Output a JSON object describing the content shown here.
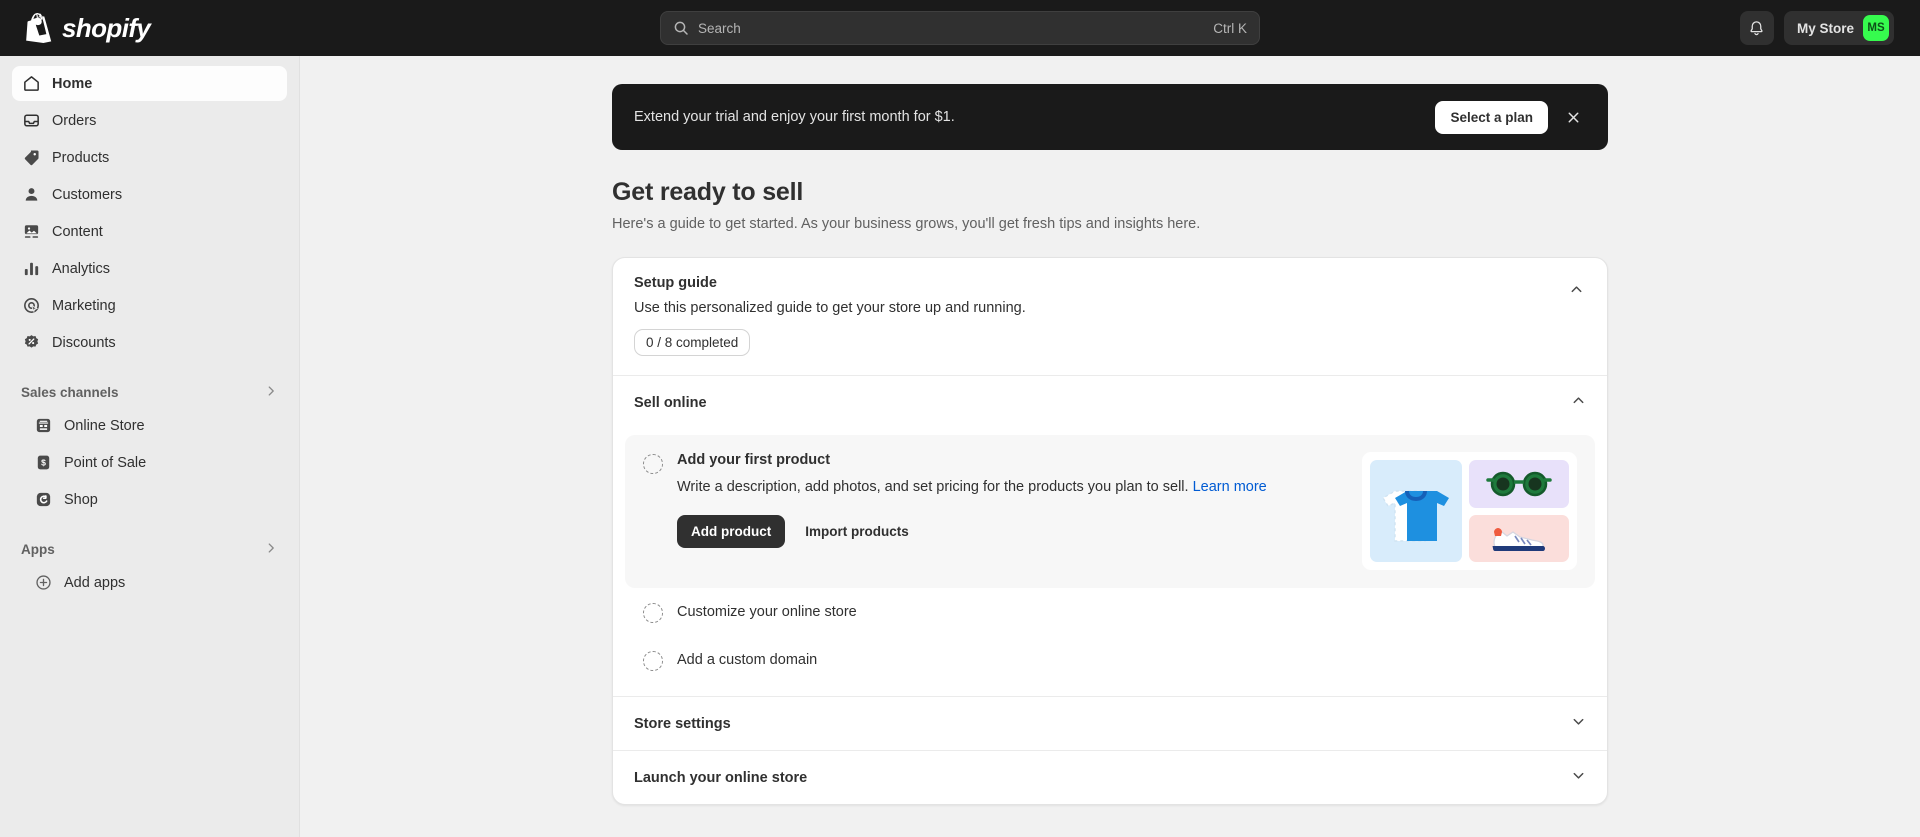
{
  "topbar": {
    "logo_text": "shopify",
    "logo_icon": "shopify-bag-icon",
    "search": {
      "placeholder": "Search",
      "icon": "search-icon",
      "shortcut": "Ctrl K"
    },
    "notifications_icon": "bell-icon",
    "store_name": "My Store",
    "avatar_initials": "MS",
    "avatar_color": "#36fb4e"
  },
  "sidebar": {
    "items": [
      {
        "label": "Home",
        "icon": "home-icon",
        "active": true
      },
      {
        "label": "Orders",
        "icon": "orders-inbox-icon",
        "active": false
      },
      {
        "label": "Products",
        "icon": "product-tag-icon",
        "active": false
      },
      {
        "label": "Customers",
        "icon": "person-icon",
        "active": false
      },
      {
        "label": "Content",
        "icon": "content-image-icon",
        "active": false
      },
      {
        "label": "Analytics",
        "icon": "bar-chart-icon",
        "active": false
      },
      {
        "label": "Marketing",
        "icon": "marketing-target-icon",
        "active": false
      },
      {
        "label": "Discounts",
        "icon": "discount-badge-icon",
        "active": false
      }
    ],
    "sales_channels": {
      "label": "Sales channels",
      "chevron_icon": "chevron-right-icon",
      "items": [
        {
          "label": "Online Store",
          "icon": "storefront-icon"
        },
        {
          "label": "Point of Sale",
          "icon": "point-of-sale-icon"
        },
        {
          "label": "Shop",
          "icon": "shop-icon"
        }
      ]
    },
    "apps": {
      "label": "Apps",
      "chevron_icon": "chevron-right-icon",
      "items": [
        {
          "label": "Add apps",
          "icon": "circle-plus-icon"
        }
      ]
    }
  },
  "banner": {
    "message": "Extend your trial and enjoy your first month for $1.",
    "cta_label": "Select a plan",
    "close_icon": "close-icon"
  },
  "page": {
    "title": "Get ready to sell",
    "subtitle": "Here's a guide to get started. As your business grows, you'll get fresh tips and insights here."
  },
  "setup_guide": {
    "title": "Setup guide",
    "description": "Use this personalized guide to get your store up and running.",
    "progress_label": "0 / 8 completed",
    "completed_count": 0,
    "total_count": 8,
    "collapse_icon": "chevron-up-icon",
    "sections": [
      {
        "label": "Sell online",
        "expanded": true,
        "toggle_icon": "chevron-up-icon",
        "tasks": [
          {
            "title": "Add your first product",
            "description": "Write a description, add photos, and set pricing for the products you plan to sell.",
            "link_label": "Learn more",
            "primary_button": "Add product",
            "secondary_button": "Import products",
            "status_icon": "incomplete-circle-icon",
            "thumbnails": [
              {
                "name": "tshirt-illustration",
                "bg": "#d8ecfb"
              },
              {
                "name": "sunglasses-illustration",
                "bg": "#e8e1fa"
              },
              {
                "name": "sneaker-illustration",
                "bg": "#fbdedb"
              }
            ]
          },
          {
            "title": "Customize your online store",
            "status_icon": "incomplete-circle-icon"
          },
          {
            "title": "Add a custom domain",
            "status_icon": "incomplete-circle-icon"
          }
        ]
      },
      {
        "label": "Store settings",
        "expanded": false,
        "toggle_icon": "chevron-down-icon"
      },
      {
        "label": "Launch your online store",
        "expanded": false,
        "toggle_icon": "chevron-down-icon"
      }
    ]
  }
}
